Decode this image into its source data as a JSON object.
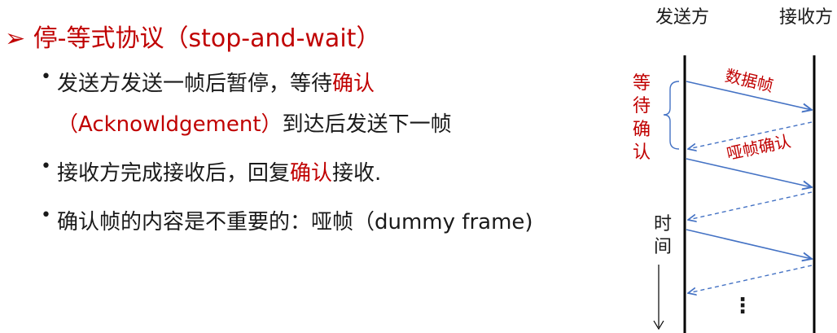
{
  "title": {
    "marker": "➢",
    "text": "停-等式协议（stop-and-wait）"
  },
  "bullets": [
    {
      "dot": "•",
      "line1_a": "发送方发送一帧后暂停，等待",
      "line1_b": "确认",
      "line2_a": "（Acknowldgement）",
      "line2_b": "到达后发送下一帧"
    },
    {
      "dot": "•",
      "a": "接收方完成接收后，回复",
      "b": "确认",
      "c": "接收."
    },
    {
      "dot": "•",
      "text": "确认帧的内容是不重要的：哑帧（dummy frame)"
    }
  ],
  "diagram": {
    "sender_label": "发送方",
    "receiver_label": "接收方",
    "wait_ack_chars": [
      "等",
      "待",
      "确",
      "认"
    ],
    "data_frame_label": "数据帧",
    "dummy_ack_label": "哑帧确认",
    "time_chars": [
      "时",
      "间"
    ],
    "ellipsis": "⋮",
    "colors": {
      "red": "#c00000",
      "arrow_blue": "#4472c4",
      "line": "#000000"
    }
  }
}
